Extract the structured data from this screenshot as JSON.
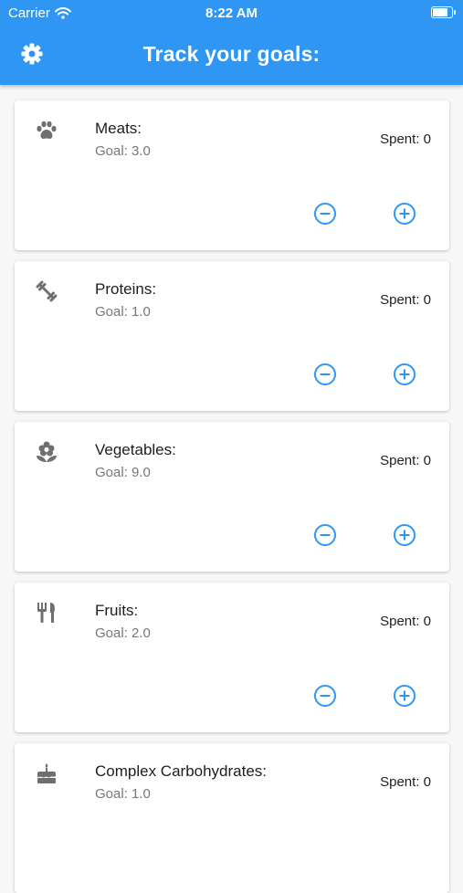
{
  "status_bar": {
    "carrier": "Carrier",
    "time": "8:22 AM",
    "battery_level": 0.9
  },
  "app_bar": {
    "title": "Track your goals:",
    "settings_icon": "gear-icon"
  },
  "colors": {
    "accent": "#2f96f3",
    "icon_gray": "#6f6f6f",
    "control_blue": "#2f96f3"
  },
  "categories": [
    {
      "name": "Meats:",
      "goal": "Goal: 3.0",
      "spent": "Spent: 0",
      "icon": "paw-icon"
    },
    {
      "name": "Proteins:",
      "goal": "Goal: 1.0",
      "spent": "Spent: 0",
      "icon": "dumbbell-icon"
    },
    {
      "name": "Vegetables:",
      "goal": "Goal: 9.0",
      "spent": "Spent: 0",
      "icon": "flower-icon"
    },
    {
      "name": "Fruits:",
      "goal": "Goal: 2.0",
      "spent": "Spent: 0",
      "icon": "utensils-icon"
    },
    {
      "name": "Complex Carbohydrates:",
      "goal": "Goal: 1.0",
      "spent": "Spent: 0",
      "icon": "cake-icon"
    }
  ],
  "controls": {
    "decrease_icon": "minus-circle-icon",
    "increase_icon": "plus-circle-icon"
  }
}
